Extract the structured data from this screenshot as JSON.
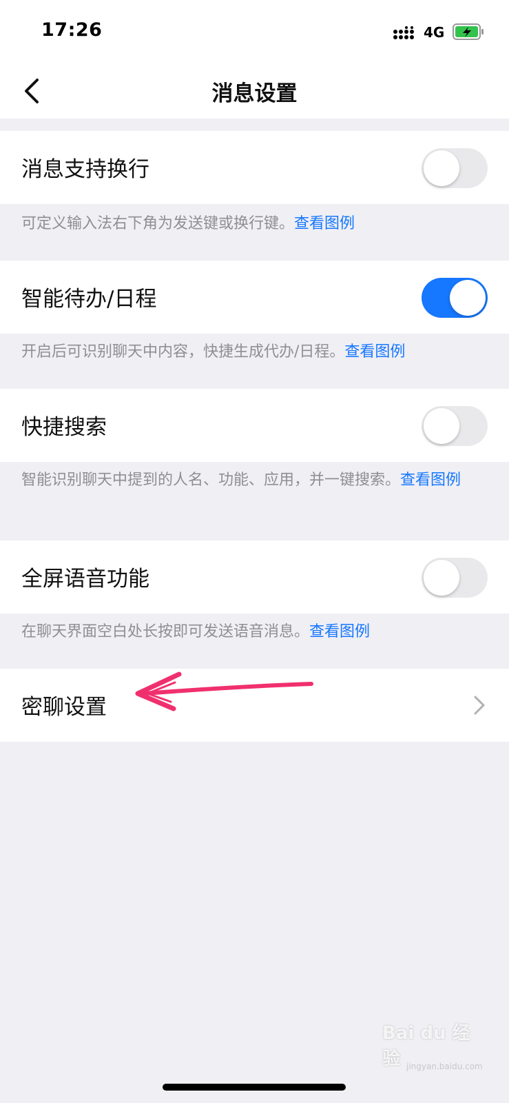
{
  "status_bar": {
    "time": "17:26",
    "network": "4G",
    "icons": [
      "signal-icon",
      "battery-charging-icon"
    ]
  },
  "nav": {
    "title": "消息设置",
    "back_icon": "chevron-left-icon"
  },
  "settings": [
    {
      "label": "消息支持换行",
      "enabled": false,
      "description": "可定义输入法右下角为发送键或换行键。",
      "link": "查看图例"
    },
    {
      "label": "智能待办/日程",
      "enabled": true,
      "description": "开启后可识别聊天中内容，快捷生成代办/日程。",
      "link": "查看图例"
    },
    {
      "label": "快捷搜索",
      "enabled": false,
      "description": "智能识别聊天中提到的人名、功能、应用，并一键搜索。",
      "link": "查看图例"
    },
    {
      "label": "全屏语音功能",
      "enabled": false,
      "description": "在聊天界面空白处长按即可发送语音消息。",
      "link": "查看图例"
    }
  ],
  "secret_chat": {
    "label": "密聊设置",
    "icon": "chevron-right-icon"
  },
  "annotation": {
    "arrow_color": "#f0306e",
    "icon": "arrow-annotation-icon"
  },
  "watermark": {
    "text": "Bai du 经验",
    "sub": "jingyan.baidu.com"
  },
  "colors": {
    "accent": "#1677ff",
    "background": "#efeff4",
    "toggle_off": "#e9e9eb"
  }
}
